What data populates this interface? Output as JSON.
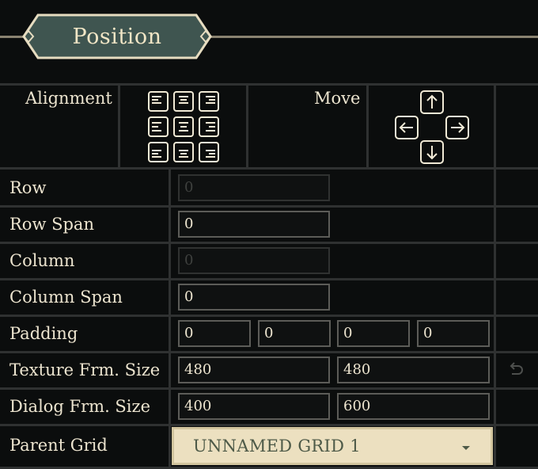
{
  "section": {
    "title": "Position"
  },
  "alignment": {
    "label": "Alignment",
    "options": [
      "top-left",
      "top-center",
      "top-right",
      "middle-left",
      "middle-center",
      "middle-right",
      "bottom-left",
      "bottom-center",
      "bottom-right"
    ]
  },
  "move": {
    "label": "Move",
    "directions": [
      "up",
      "left",
      "right",
      "down"
    ]
  },
  "fields": {
    "row": {
      "label": "Row",
      "value": "0",
      "disabled": true
    },
    "row_span": {
      "label": "Row Span",
      "value": "0"
    },
    "column": {
      "label": "Column",
      "value": "0",
      "disabled": true
    },
    "column_span": {
      "label": "Column Span",
      "value": "0"
    },
    "padding": {
      "label": "Padding",
      "values": [
        "0",
        "0",
        "0",
        "0"
      ]
    },
    "texture_frame_size": {
      "label": "Texture Frm. Size",
      "values": [
        "480",
        "480"
      ],
      "reset_icon": "undo-icon"
    },
    "dialog_frame_size": {
      "label": "Dialog Frm. Size",
      "values": [
        "400",
        "600"
      ]
    },
    "parent_grid": {
      "label": "Parent Grid",
      "selected": "UNNAMED GRID 1"
    }
  },
  "colors": {
    "background": "#0b0d0d",
    "grid_line": "#2f3131",
    "header_badge": "#3f5550",
    "header_border": "#e6dcc0",
    "dropdown_bg": "#ece0c0",
    "dropdown_text": "#4e5a48"
  }
}
